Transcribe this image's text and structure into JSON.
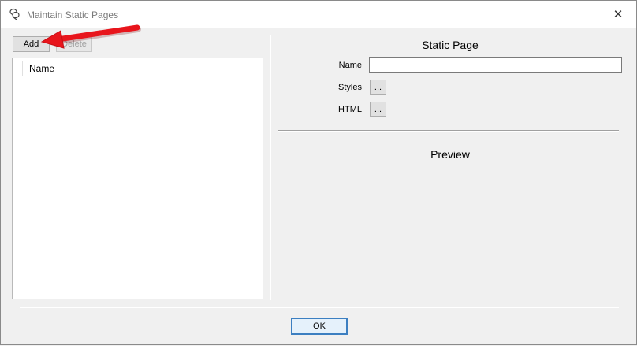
{
  "window": {
    "title": "Maintain Static Pages",
    "close_label": "✕"
  },
  "toolbar": {
    "add_label": "Add",
    "delete_label": "Delete"
  },
  "list": {
    "column_header": "Name"
  },
  "static_page": {
    "heading": "Static Page",
    "name_label": "Name",
    "name_value": "",
    "styles_label": "Styles",
    "styles_button": "...",
    "html_label": "HTML",
    "html_button": "..."
  },
  "preview": {
    "heading": "Preview"
  },
  "footer": {
    "ok_label": "OK"
  },
  "colors": {
    "annotation_arrow": "#e8151c",
    "ok_focus": "#3c7fc1"
  }
}
